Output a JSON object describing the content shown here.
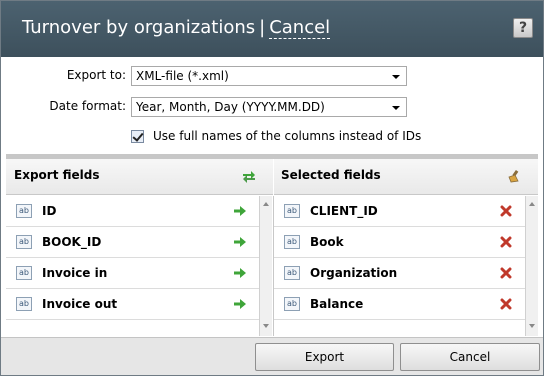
{
  "dialog": {
    "title": "Turnover by organizations",
    "separator": "|",
    "cancel_link": "Cancel",
    "help": "?"
  },
  "form": {
    "export_to_label": "Export to:",
    "export_to_value": "XML-file (*.xml)",
    "date_format_label": "Date format:",
    "date_format_value": "Year, Month, Day (YYYY.MM.DD)",
    "full_names_label": "Use full names of the columns instead of IDs",
    "full_names_checked": true
  },
  "export_fields": {
    "header": "Export fields",
    "items": [
      {
        "label": "ID",
        "type_badge": "ab"
      },
      {
        "label": "BOOK_ID",
        "type_badge": "ab"
      },
      {
        "label": "Invoice in",
        "type_badge": "ab"
      },
      {
        "label": "Invoice out",
        "type_badge": "ab"
      }
    ]
  },
  "selected_fields": {
    "header": "Selected fields",
    "items": [
      {
        "label": "CLIENT_ID",
        "type_badge": "ab"
      },
      {
        "label": "Book",
        "type_badge": "ab"
      },
      {
        "label": "Organization",
        "type_badge": "ab"
      },
      {
        "label": "Balance",
        "type_badge": "ab"
      }
    ]
  },
  "buttons": {
    "export": "Export",
    "cancel": "Cancel"
  },
  "colors": {
    "titlebar": "#445966",
    "add_arrow": "#3fa53a",
    "remove_x": "#c0392b"
  }
}
